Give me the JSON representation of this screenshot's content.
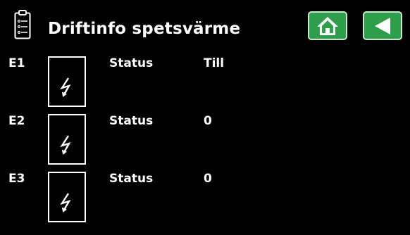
{
  "header": {
    "title": "Driftinfo spetsvärme",
    "icon": "clipboard-list-icon",
    "home_icon": "home-icon",
    "back_icon": "back-arrow-icon",
    "button_color": "#2e9e4b"
  },
  "rows": [
    {
      "label": "E1",
      "icon": "electric-heater-icon",
      "status_label": "Status",
      "status_value": "Till"
    },
    {
      "label": "E2",
      "icon": "electric-heater-icon",
      "status_label": "Status",
      "status_value": "0"
    },
    {
      "label": "E3",
      "icon": "electric-heater-icon",
      "status_label": "Status",
      "status_value": "0"
    }
  ]
}
